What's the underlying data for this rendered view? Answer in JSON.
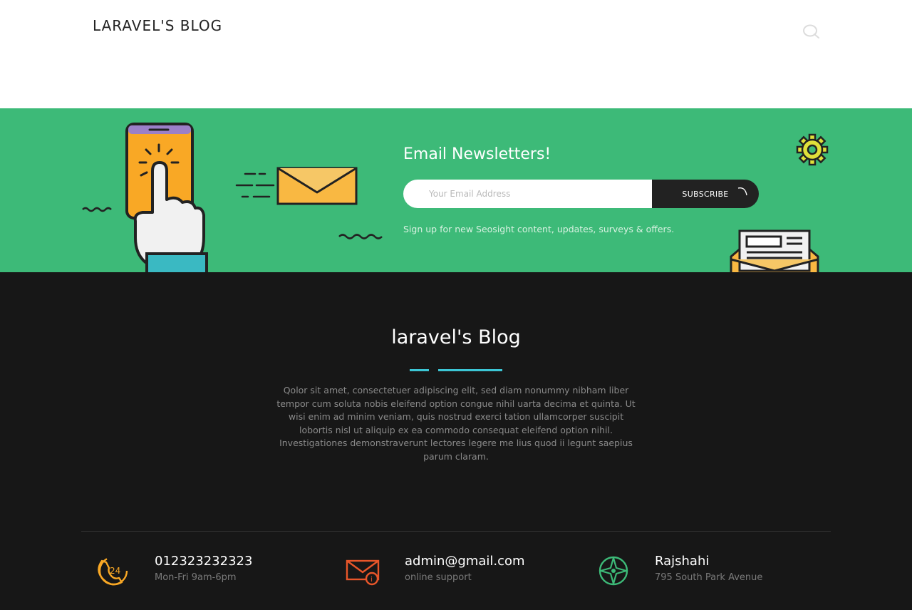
{
  "header": {
    "logo": "LARAVEL'S BLOG"
  },
  "newsletter": {
    "title": "Email Newsletters!",
    "email_placeholder": "Your Email Address",
    "subscribe_label": "SUBSCRIBE",
    "note": "Sign up for new Seosight content, updates, surveys & offers."
  },
  "footer": {
    "title": "laravel's Blog",
    "description": "Qolor sit amet, consectetuer adipiscing elit, sed diam nonummy nibham liber tempor cum soluta nobis eleifend option congue nihil uarta decima et quinta. Ut wisi enim ad minim veniam, quis nostrud exerci tation ullamcorper suscipit lobortis nisl ut aliquip ex ea commodo consequat eleifend option nihil. Investigationes demonstraverunt lectores legere me lius quod ii legunt saepius parum claram.",
    "contacts": [
      {
        "icon": "phone-24-icon",
        "main": "012323232323",
        "sub": "Mon-Fri 9am-6pm"
      },
      {
        "icon": "mail-info-icon",
        "main": "admin@gmail.com",
        "sub": "online support"
      },
      {
        "icon": "compass-icon",
        "main": "Rajshahi",
        "sub": "795 South Park Avenue"
      }
    ]
  },
  "colors": {
    "accent_green": "#3dba78",
    "footer_bg": "#171717",
    "accent_cyan": "#3cc6d5",
    "icon_orange": "#f9a825",
    "icon_red": "#e8562a",
    "icon_green": "#3dba78"
  }
}
